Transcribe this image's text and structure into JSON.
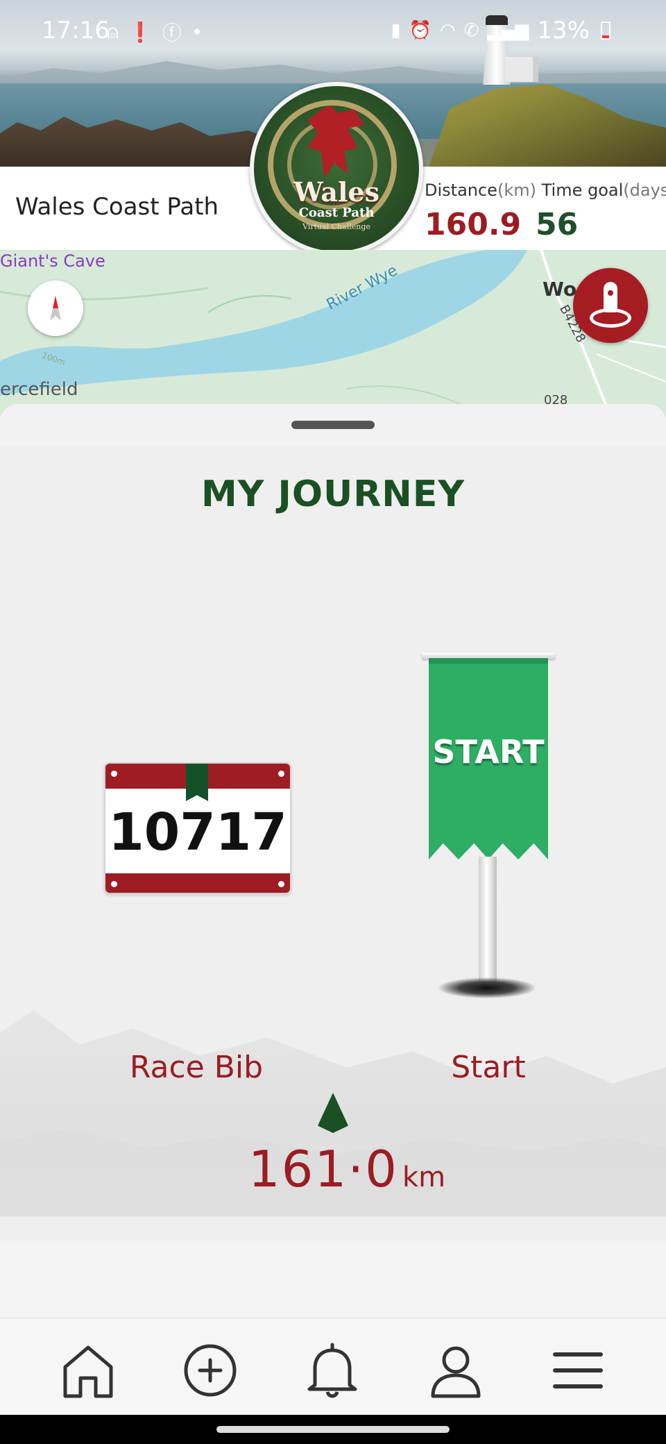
{
  "status_bar": {
    "time": "17:16",
    "battery": "13%"
  },
  "header": {
    "route_name": "Wales Coast Path",
    "logo": {
      "title": "Wales",
      "subtitle": "Coast Path",
      "tagline": "Virtual Challenge"
    },
    "distance_label": "Distance",
    "distance_unit": "(km)",
    "distance_value": "160.9",
    "time_goal_label": "Time goal",
    "time_goal_unit": "(days)",
    "time_goal_value": "56"
  },
  "map": {
    "labels": {
      "giants_cave": "Giant's Cave",
      "river": "River Wye",
      "place_left": "ercefield",
      "place_right": "Wo",
      "road": "B4228",
      "road2": "028",
      "contour": "100m"
    }
  },
  "journey": {
    "title": "MY JOURNEY",
    "bib_number": "10717",
    "bib_label": "Race Bib",
    "flag_text": "START",
    "start_label": "Start",
    "total_distance": "161·0",
    "total_unit": "km"
  },
  "nav": {
    "items": [
      "home-icon",
      "add-circle-icon",
      "bell-icon",
      "profile-icon",
      "menu-icon"
    ]
  },
  "colors": {
    "brand_red": "#9b1c22",
    "brand_green": "#1a5024",
    "flag_green": "#2eae64"
  }
}
